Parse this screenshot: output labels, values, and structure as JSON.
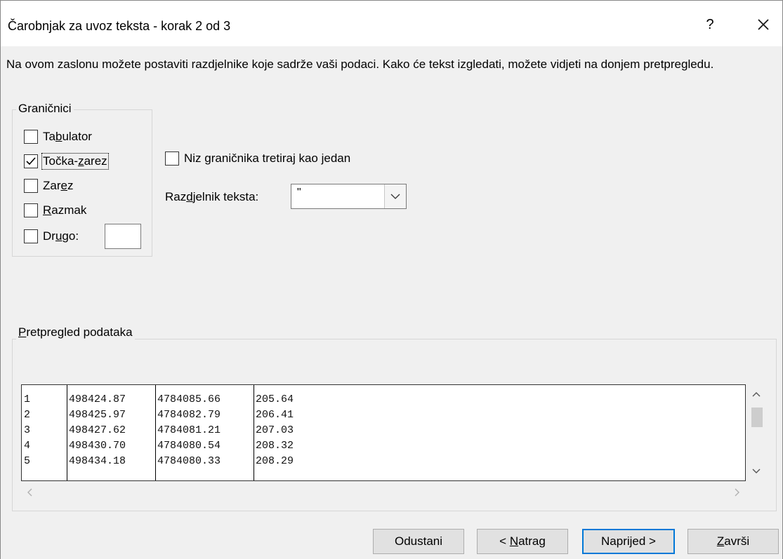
{
  "window": {
    "title": "Čarobnjak za uvoz teksta - korak 2 od 3",
    "help": "?",
    "close_icon": "close-icon"
  },
  "description": "Na ovom zaslonu možete postaviti razdjelnike koje sadrže vaši podaci. Kako će tekst izgledati, možete vidjeti na donjem pretpregledu.",
  "delimiters": {
    "legend": "Graničnici",
    "items": [
      {
        "pre": "Ta",
        "key": "b",
        "post": "ulator",
        "checked": false
      },
      {
        "pre": "Točka-",
        "key": "z",
        "post": "arez",
        "checked": true
      },
      {
        "pre": "Zar",
        "key": "e",
        "post": "z",
        "checked": false
      },
      {
        "pre": "",
        "key": "R",
        "post": "azmak",
        "checked": false
      },
      {
        "pre": "Dr",
        "key": "u",
        "post": "go:",
        "checked": false
      }
    ],
    "other_value": ""
  },
  "consecutive": {
    "pre": "Niz ",
    "key": "g",
    "post": "raničnika tretiraj kao jedan",
    "checked": false
  },
  "qualifier": {
    "pre": "Raz",
    "key": "d",
    "post": "jelnik teksta:",
    "value": "\""
  },
  "preview": {
    "legend_key": "P",
    "legend_rest": "retpregled podataka",
    "rows": [
      [
        "1",
        "498424.87",
        "4784085.66",
        "205.64"
      ],
      [
        "2",
        "498425.97",
        "4784082.79",
        "206.41"
      ],
      [
        "3",
        "498427.62",
        "4784081.21",
        "207.03"
      ],
      [
        "4",
        "498430.70",
        "4784080.54",
        "208.32"
      ],
      [
        "5",
        "498434.18",
        "4784080.33",
        "208.29"
      ]
    ]
  },
  "buttons": {
    "cancel": "Odustani",
    "back_pre": "< ",
    "back_key": "N",
    "back_post": "atrag",
    "next_pre": "Napri",
    "next_key": "j",
    "next_post": "ed >",
    "finish_key": "Z",
    "finish_post": "avrši"
  },
  "colors": {
    "default_button_border": "#0078d7",
    "dialog_bg": "#f0f0f0"
  }
}
